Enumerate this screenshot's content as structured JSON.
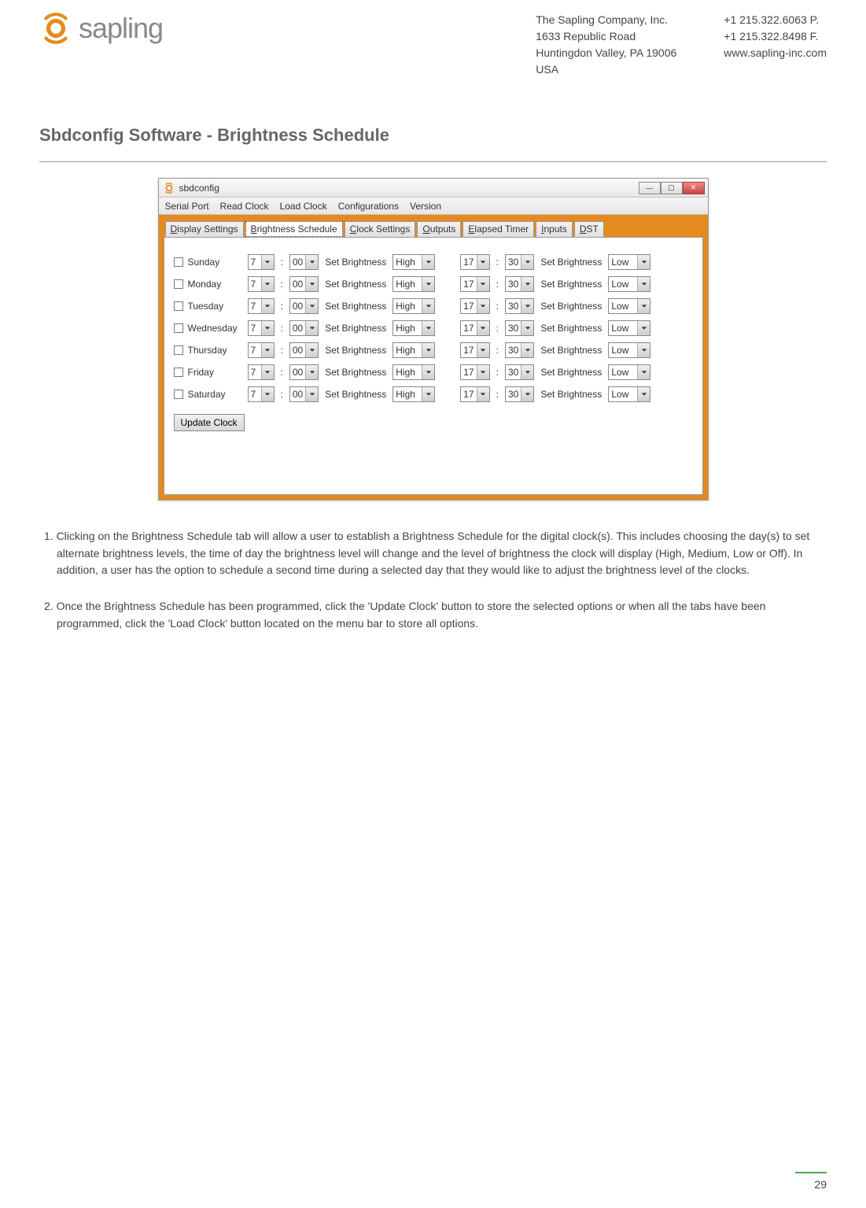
{
  "header": {
    "brand": "sapling",
    "address": {
      "line1": "The Sapling Company, Inc.",
      "line2": "1633 Republic Road",
      "line3": "Huntingdon Valley, PA 19006",
      "line4": "USA"
    },
    "contact": {
      "phone": "+1 215.322.6063 P.",
      "fax": "+1 215.322.8498 F.",
      "web": "www.sapling-inc.com"
    }
  },
  "section_title": "Sbdconfig Software - Brightness Schedule",
  "window": {
    "title": "sbdconfig",
    "menus": [
      "Serial Port",
      "Read Clock",
      "Load Clock",
      "Configurations",
      "Version"
    ],
    "tabs": [
      "Display Settings",
      "Brightness Schedule",
      "Clock Settings",
      "Outputs",
      "Elapsed Timer",
      "Inputs",
      "DST"
    ],
    "active_tab_index": 1,
    "set_brightness_label": "Set Brightness",
    "update_button": "Update Clock",
    "rows": [
      {
        "day": "Sunday",
        "h1": "7",
        "m1": "00",
        "b1": "High",
        "h2": "17",
        "m2": "30",
        "b2": "Low"
      },
      {
        "day": "Monday",
        "h1": "7",
        "m1": "00",
        "b1": "High",
        "h2": "17",
        "m2": "30",
        "b2": "Low"
      },
      {
        "day": "Tuesday",
        "h1": "7",
        "m1": "00",
        "b1": "High",
        "h2": "17",
        "m2": "30",
        "b2": "Low"
      },
      {
        "day": "Wednesday",
        "h1": "7",
        "m1": "00",
        "b1": "High",
        "h2": "17",
        "m2": "30",
        "b2": "Low"
      },
      {
        "day": "Thursday",
        "h1": "7",
        "m1": "00",
        "b1": "High",
        "h2": "17",
        "m2": "30",
        "b2": "Low"
      },
      {
        "day": "Friday",
        "h1": "7",
        "m1": "00",
        "b1": "High",
        "h2": "17",
        "m2": "30",
        "b2": "Low"
      },
      {
        "day": "Saturday",
        "h1": "7",
        "m1": "00",
        "b1": "High",
        "h2": "17",
        "m2": "30",
        "b2": "Low"
      }
    ]
  },
  "instructions": {
    "p1": "1. Clicking on the Brightness Schedule tab will allow a user to establish a Brightness Schedule for the digital clock(s). This includes choosing the day(s) to set alternate brightness levels, the time of day the brightness level will change and the level of brightness the clock will display (High, Medium, Low or Off). In addition, a user has the option to schedule a second time during a selected day that they would like to adjust the brightness level of the clocks.",
    "p2": "2. Once the Brightness Schedule has been programmed, click the 'Update Clock' button to store the selected options or when all the tabs have been programmed, click the 'Load Clock' button located on the menu bar to store all options."
  },
  "page_number": "29"
}
